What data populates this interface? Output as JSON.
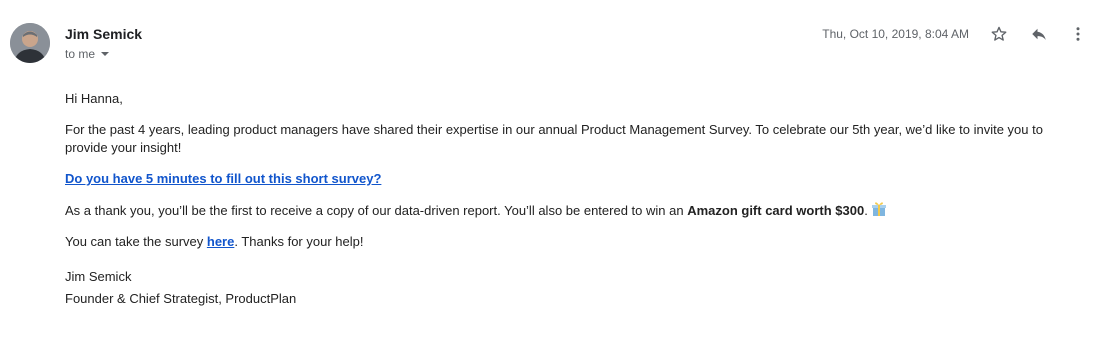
{
  "email": {
    "sender_name": "Jim Semick",
    "recipient": "to me",
    "timestamp": "Thu, Oct 10, 2019, 8:04 AM"
  },
  "toolbar": {
    "star_icon": "star-icon",
    "reply_icon": "reply-icon",
    "more_icon": "more-vert-icon"
  },
  "body": {
    "greeting": "Hi Hanna,",
    "paragraph1": "For the past 4 years, leading product managers have shared their expertise in our annual Product Management Survey. To celebrate our 5th year, we’d like to invite you to provide your insight!",
    "survey_link": "Do you have 5 minutes to fill out this short survey?",
    "thanks_prefix": "As a thank you, you’ll be the first to receive a copy of our data-driven report. You’ll also be entered to win an ",
    "thanks_bold": "Amazon gift card worth $300",
    "thanks_suffix": ".",
    "gift_icon": "gift-icon",
    "take_prefix": "You can take the survey ",
    "take_link": "here",
    "take_suffix": ". Thanks for your help!",
    "signature_name": "Jim Semick",
    "signature_title": "Founder & Chief Strategist, ProductPlan"
  },
  "colors": {
    "link": "#1155cc",
    "meta_text": "#5f6368",
    "body_text": "#222222"
  }
}
